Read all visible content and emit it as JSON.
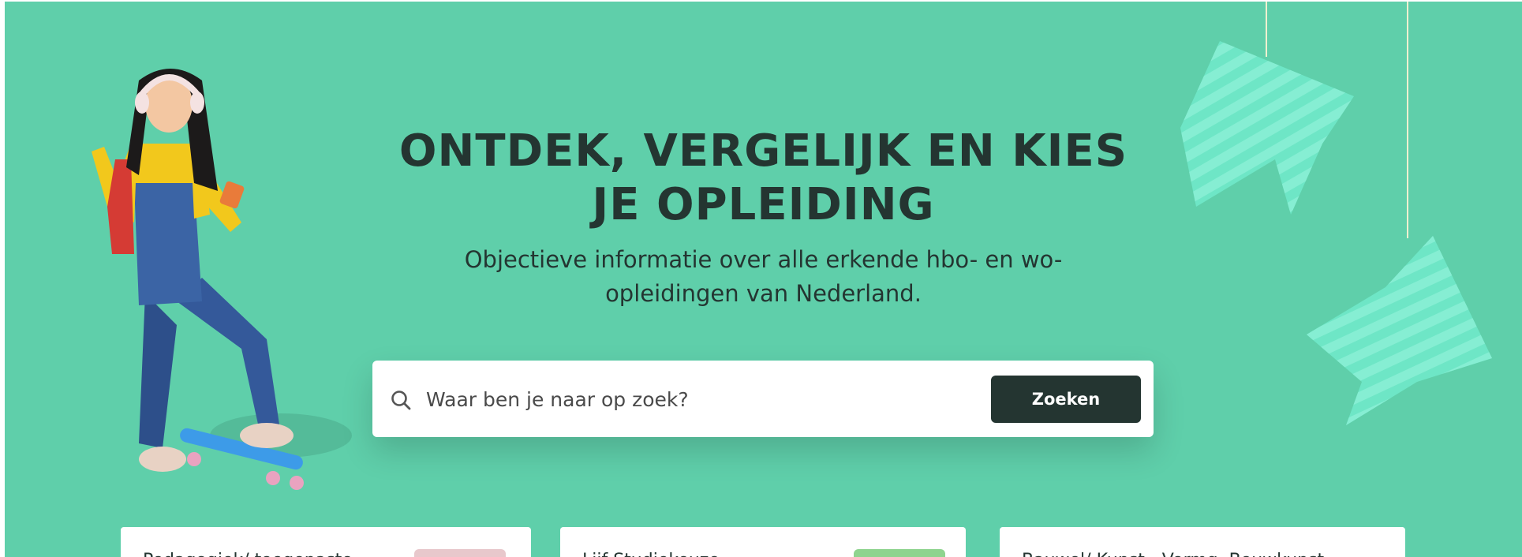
{
  "hero": {
    "title_line1": "ONTDEK, VERGELIJK EN KIES",
    "title_line2": "JE OPLEIDING",
    "subtitle_line1": "Objectieve informatie over alle erkende hbo- en wo-",
    "subtitle_line2": "opleidingen van Nederland."
  },
  "search": {
    "icon": "search-icon",
    "placeholder": "Waar ben je naar op zoek?",
    "value": "",
    "button_label": "Zoeken"
  },
  "decorations": {
    "illustration": "student-with-skateboard-illustration",
    "hanging_arrows": "hanging-arrow-icon"
  },
  "colors": {
    "hero_background": "#5fcfaa",
    "text_dark": "#243531",
    "button_background": "#243531",
    "arrow_fill": "#6ee6c6",
    "arrow_stripe": "#8cf0d6"
  },
  "cards": [
    {
      "text": "Pedagogiek/ toegepaste",
      "thumb_color": "#e8c8cc"
    },
    {
      "text": "Lijf Studiekeuze",
      "thumb_color": "#8fd48f"
    },
    {
      "text": "Bauwel/ Kunst - Vormg. Bouwkunst",
      "thumb_color": ""
    }
  ]
}
